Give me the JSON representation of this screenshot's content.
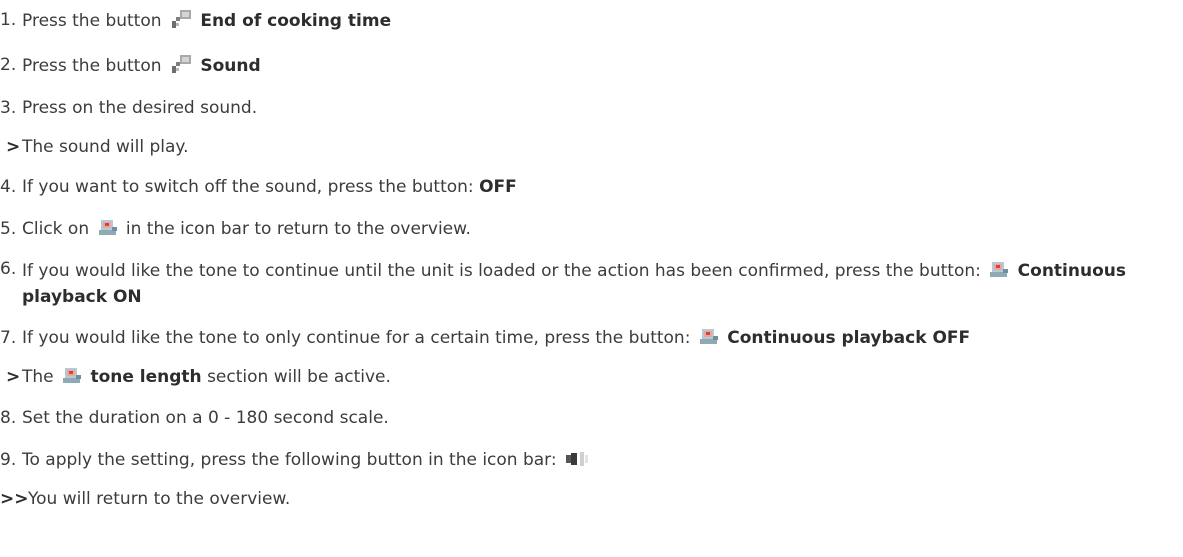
{
  "steps": [
    {
      "marker": "1.",
      "text": "Press the button",
      "icon": "food-probe-icon",
      "bold": "End of cooking time"
    },
    {
      "marker": "2.",
      "text": "Press the button",
      "icon": "food-probe-icon",
      "bold": "Sound"
    },
    {
      "marker": "3.",
      "text": "Press on the desired sound."
    },
    {
      "marker": ">",
      "text": "The sound will play."
    },
    {
      "marker": "4.",
      "text": "If you want to switch off the sound, press the button:",
      "bold": "OFF"
    },
    {
      "marker": "5.",
      "text_before": "Click on",
      "icon": "repeat-sound-icon",
      "text_after": "in the icon bar to return to the overview."
    },
    {
      "marker": "6.",
      "text": "If you would like the tone to continue until the unit is loaded or the action has been confirmed, press the button:",
      "icon": "repeat-sound-icon",
      "bold": "Continuous playback ON"
    },
    {
      "marker": "7.",
      "text": "If you would like the tone to only continue for a certain time, press the button:",
      "icon": "repeat-sound-icon",
      "bold": "Continuous playback OFF"
    },
    {
      "marker": ">",
      "text_before": "The",
      "icon": "repeat-sound-icon",
      "bold": "tone length",
      "text_after": "section will be active."
    },
    {
      "marker": "8.",
      "text": "Set the duration on a 0 - 180 second scale."
    },
    {
      "marker": "9.",
      "text": "To apply the setting, press the following button in the icon bar:",
      "icon": "apply-settings-icon"
    },
    {
      "marker": ">>",
      "text": "You will return to the overview."
    }
  ]
}
